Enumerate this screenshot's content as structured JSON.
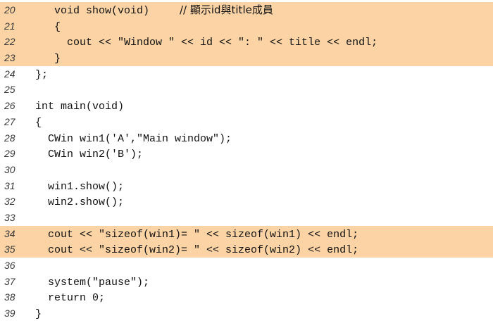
{
  "lines": [
    {
      "num": "20",
      "text": "   void show(void)",
      "comment": "         // 顯示id與title成員",
      "highlight": true
    },
    {
      "num": "21",
      "text": "   {",
      "comment": "",
      "highlight": true
    },
    {
      "num": "22",
      "text": "     cout << \"Window \" << id << \": \" << title << endl;",
      "comment": "",
      "highlight": true
    },
    {
      "num": "23",
      "text": "   }",
      "comment": "",
      "highlight": true
    },
    {
      "num": "24",
      "text": "};",
      "comment": "",
      "highlight": false
    },
    {
      "num": "25",
      "text": "",
      "comment": "",
      "highlight": false
    },
    {
      "num": "26",
      "text": "int main(void)",
      "comment": "",
      "highlight": false
    },
    {
      "num": "27",
      "text": "{",
      "comment": "",
      "highlight": false
    },
    {
      "num": "28",
      "text": "  CWin win1('A',\"Main window\");",
      "comment": "",
      "highlight": false
    },
    {
      "num": "29",
      "text": "  CWin win2('B');",
      "comment": "",
      "highlight": false
    },
    {
      "num": "30",
      "text": "",
      "comment": "",
      "highlight": false
    },
    {
      "num": "31",
      "text": "  win1.show();",
      "comment": "",
      "highlight": false
    },
    {
      "num": "32",
      "text": "  win2.show();",
      "comment": "",
      "highlight": false
    },
    {
      "num": "33",
      "text": "",
      "comment": "",
      "highlight": false
    },
    {
      "num": "34",
      "text": "  cout << \"sizeof(win1)= \" << sizeof(win1) << endl;",
      "comment": "",
      "highlight": true
    },
    {
      "num": "35",
      "text": "  cout << \"sizeof(win2)= \" << sizeof(win2) << endl;",
      "comment": "",
      "highlight": true
    },
    {
      "num": "36",
      "text": "",
      "comment": "",
      "highlight": false
    },
    {
      "num": "37",
      "text": "  system(\"pause\");",
      "comment": "",
      "highlight": false
    },
    {
      "num": "38",
      "text": "  return 0;",
      "comment": "",
      "highlight": false
    },
    {
      "num": "39",
      "text": "}",
      "comment": "",
      "highlight": false
    }
  ],
  "colors": {
    "highlight": "#fbd3a4",
    "line_number": "#3a3a3a",
    "code_text": "#111111"
  }
}
